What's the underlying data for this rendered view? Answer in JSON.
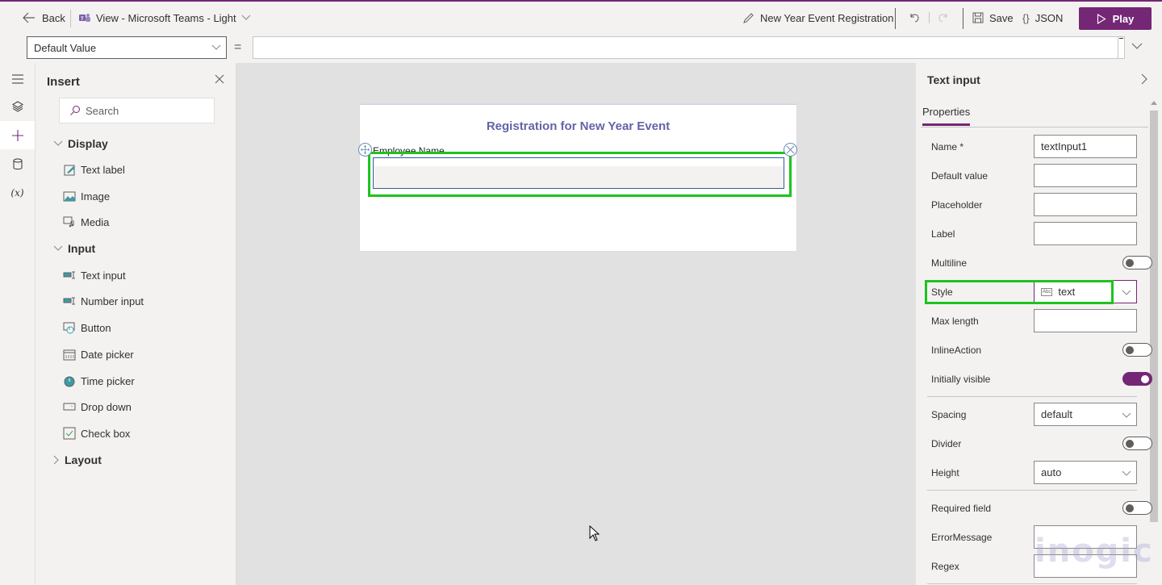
{
  "topbar": {
    "back_label": "Back",
    "view_label": "View - Microsoft Teams - Light",
    "card_name": "New Year Event Registration",
    "save_label": "Save",
    "json_label": "JSON",
    "play_label": "Play"
  },
  "formula_bar": {
    "property_selected": "Default Value",
    "equals": "=",
    "formula_value": ""
  },
  "rail": {
    "items": [
      {
        "icon": "hamburger-icon"
      },
      {
        "icon": "layers-icon"
      },
      {
        "icon": "plus-icon",
        "active": true
      },
      {
        "icon": "data-icon"
      },
      {
        "icon": "variable-icon",
        "glyph": "(x)"
      }
    ]
  },
  "insert_panel": {
    "title": "Insert",
    "search_placeholder": "Search",
    "groups": [
      {
        "label": "Display",
        "expanded": true,
        "items": [
          {
            "label": "Text label",
            "icon": "text-label-icon"
          },
          {
            "label": "Image",
            "icon": "image-icon"
          },
          {
            "label": "Media",
            "icon": "media-icon"
          }
        ]
      },
      {
        "label": "Input",
        "expanded": true,
        "items": [
          {
            "label": "Text input",
            "icon": "text-input-icon"
          },
          {
            "label": "Number input",
            "icon": "number-input-icon"
          },
          {
            "label": "Button",
            "icon": "button-icon"
          },
          {
            "label": "Date picker",
            "icon": "date-picker-icon"
          },
          {
            "label": "Time picker",
            "icon": "time-picker-icon"
          },
          {
            "label": "Drop down",
            "icon": "drop-down-icon"
          },
          {
            "label": "Check box",
            "icon": "check-box-icon"
          }
        ]
      },
      {
        "label": "Layout",
        "expanded": false,
        "items": []
      }
    ]
  },
  "canvas": {
    "card_title": "Registration for New Year Event",
    "field_label": "Employee Name",
    "field_value": ""
  },
  "properties_panel": {
    "title": "Text input",
    "tab": "Properties",
    "rows": {
      "name": {
        "label": "Name *",
        "value": "textInput1"
      },
      "default_value": {
        "label": "Default value",
        "value": ""
      },
      "placeholder": {
        "label": "Placeholder",
        "value": ""
      },
      "label": {
        "label": "Label",
        "value": ""
      },
      "multiline": {
        "label": "Multiline",
        "on": false
      },
      "style": {
        "label": "Style",
        "value": "text",
        "icon_text": "Abc"
      },
      "max_length": {
        "label": "Max length",
        "value": ""
      },
      "inline_action": {
        "label": "InlineAction",
        "on": false
      },
      "initially_visible": {
        "label": "Initially visible",
        "on": true
      },
      "spacing": {
        "label": "Spacing",
        "value": "default"
      },
      "divider": {
        "label": "Divider",
        "on": false
      },
      "height": {
        "label": "Height",
        "value": "auto"
      },
      "required_field": {
        "label": "Required field",
        "on": false
      },
      "error_message": {
        "label": "ErrorMessage",
        "value": ""
      },
      "regex": {
        "label": "Regex",
        "value": ""
      }
    }
  },
  "watermark": "inogic",
  "colors": {
    "brand": "#742774",
    "highlight": "#1ec31e",
    "card_title": "#6264a7"
  }
}
